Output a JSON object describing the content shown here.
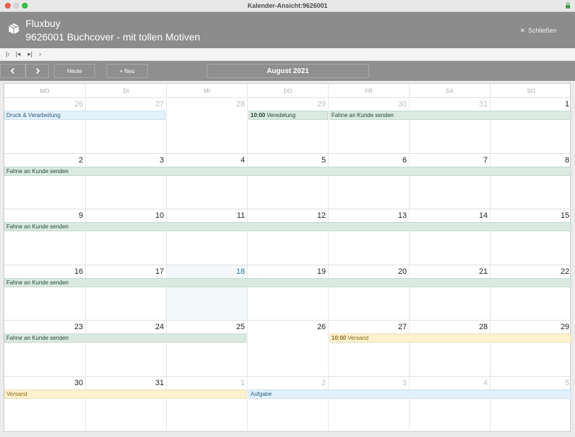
{
  "window": {
    "title": "Kalender-Ansicht:9626001"
  },
  "header": {
    "app_name": "Fluxbuy",
    "record_title": "9626001 Buchcover - mit tollen Motiven",
    "close_label": "Schließen"
  },
  "record_nav": {
    "first": "|<",
    "prev": "|<",
    "next": ">|",
    "last": ">"
  },
  "toolbar": {
    "today_label": "Heute",
    "new_label": "+ Neu",
    "month_title": "August 2021"
  },
  "weekdays": [
    "MO",
    "DI",
    "MI",
    "DO",
    "FR",
    "SA",
    "SO"
  ],
  "weeks": [
    {
      "days": [
        "26",
        "27",
        "28",
        "29",
        "30",
        "31",
        "1"
      ]
    },
    {
      "days": [
        "2",
        "3",
        "4",
        "5",
        "6",
        "7",
        "8"
      ]
    },
    {
      "days": [
        "9",
        "10",
        "11",
        "12",
        "13",
        "14",
        "15"
      ]
    },
    {
      "days": [
        "16",
        "17",
        "18",
        "19",
        "20",
        "21",
        "22"
      ]
    },
    {
      "days": [
        "23",
        "24",
        "25",
        "26",
        "27",
        "28",
        "29"
      ]
    },
    {
      "days": [
        "30",
        "31",
        "1",
        "2",
        "3",
        "4",
        "5"
      ]
    }
  ],
  "events": [
    {
      "title": "Druck & Verarbeitung"
    },
    {
      "time": "10:00",
      "title": "Veredelung"
    },
    {
      "title": "Fahne an Kunde senden"
    },
    {
      "title": "Fahne an Kunde senden"
    },
    {
      "title": "Fahne an Kunde senden"
    },
    {
      "title": "Fahne an Kunde senden"
    },
    {
      "title": "Fahne an Kunde senden"
    },
    {
      "time": "10:00",
      "title": "Versand"
    },
    {
      "title": "Versand"
    },
    {
      "title": "Aufgabe"
    }
  ],
  "colors": {
    "header": "#8c8c8c",
    "event_green": "#dae9e2",
    "event_blue": "#e3f1fa",
    "event_yellow": "#fcf2cf",
    "today": "#3a6e93"
  }
}
